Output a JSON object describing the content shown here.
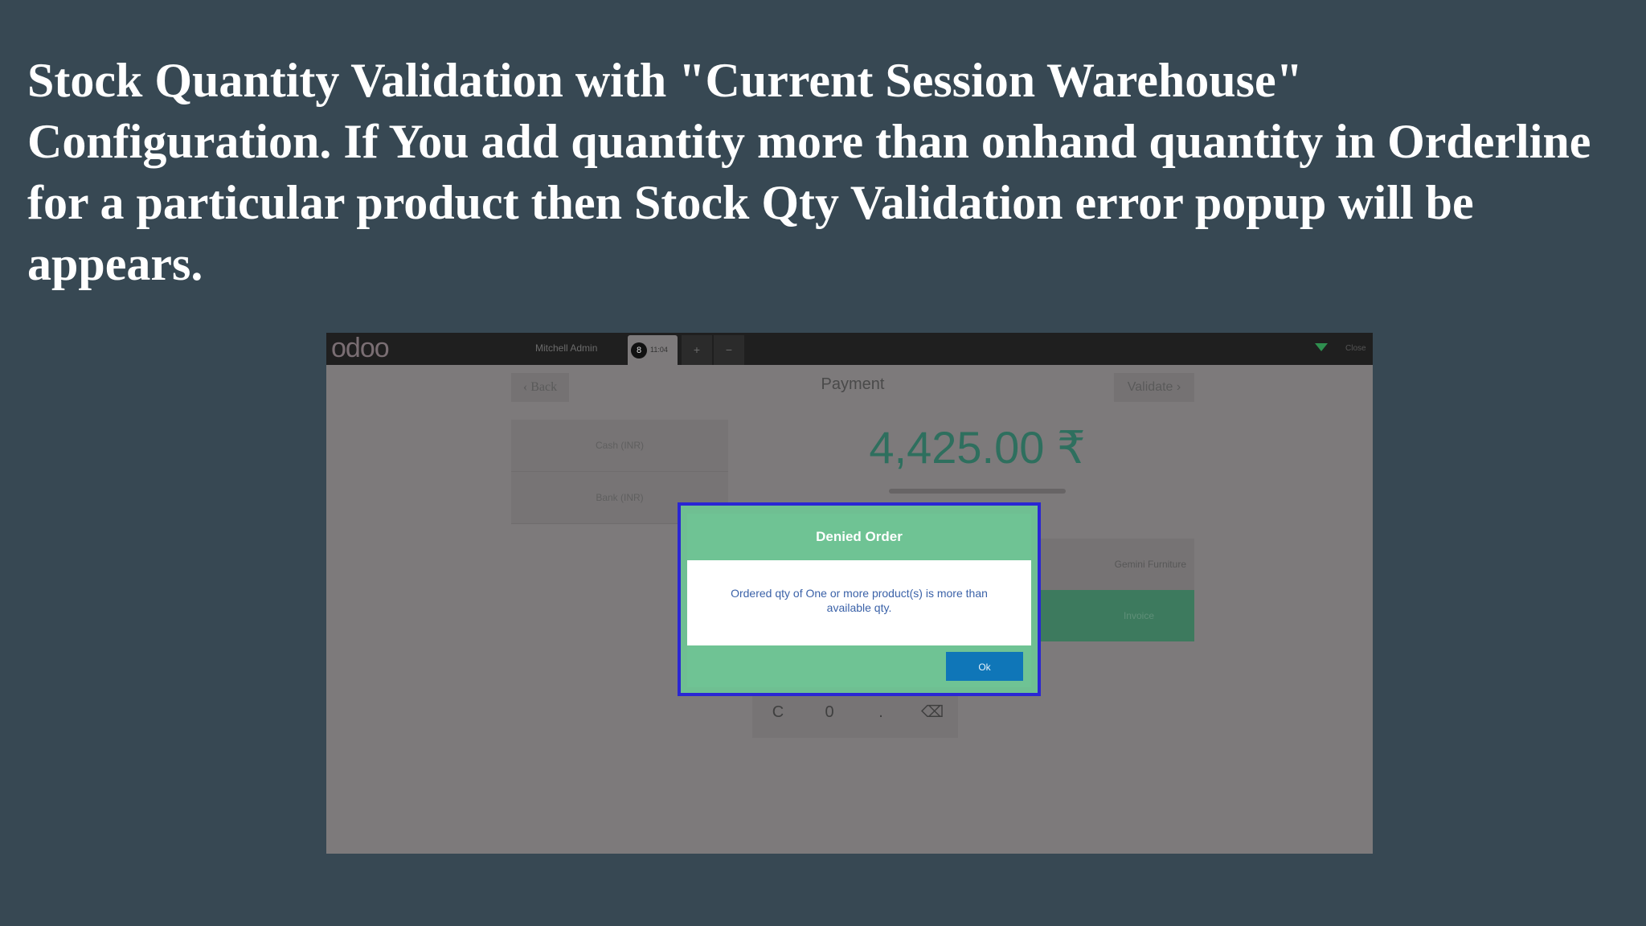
{
  "headline": "Stock Quantity Validation with \"Current Session Warehouse\" Configuration. If You add quantity more than onhand quantity in Orderline for a particular product then Stock Qty Validation error popup will be appears.",
  "pos": {
    "logo": "odoo",
    "user": "Mitchell Admin",
    "order_tab": {
      "number": "8",
      "time": "11:04"
    },
    "tab_add": "+",
    "tab_remove": "−",
    "close": "Close",
    "back_label": "‹ Back",
    "title": "Payment",
    "validate_label": "Validate ›",
    "payment_methods": [
      "Cash (INR)",
      "Bank (INR)"
    ],
    "amount": "4,425.00 ₹",
    "customer": "Gemini Furniture",
    "invoice_label": "Invoice",
    "numpad_keys": [
      "C",
      "0",
      ".",
      "⌫"
    ]
  },
  "popup": {
    "title": "Denied Order",
    "message": "Ordered qty of One or more product(s) is more than available qty.",
    "ok_label": "Ok"
  },
  "colors": {
    "background": "#374853",
    "popup_green": "#6fc394",
    "ok_blue": "#0f76b8",
    "highlight_border": "#2a26d4"
  }
}
